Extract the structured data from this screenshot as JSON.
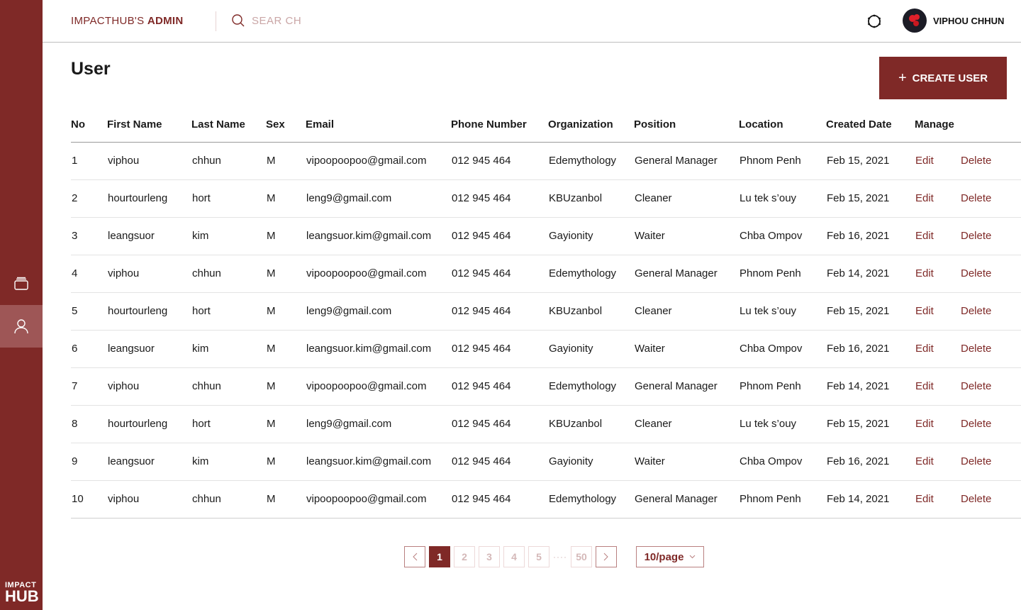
{
  "sidebar": {
    "items": [
      {
        "icon": "cards-icon",
        "label": ""
      },
      {
        "icon": "user-icon",
        "active": true
      }
    ],
    "logo_top": "IMPACT",
    "logo_bottom": "HUB"
  },
  "header": {
    "brand_light": "IMPACTHUB'S",
    "brand_bold": "ADMIN",
    "search_placeholder": "SEAR CH",
    "user_name": "VIPHOU CHHUN"
  },
  "page": {
    "title": "User",
    "create_label": "CREATE USER"
  },
  "colors": {
    "brand": "#7f2927",
    "sidebar_active": "#9e5656"
  },
  "table": {
    "columns": [
      "No",
      "First Name",
      "Last Name",
      "Sex",
      "Email",
      "Phone Number",
      "Organization",
      "Position",
      "Location",
      "Created Date",
      "Manage"
    ],
    "edit_label": "Edit",
    "delete_label": "Delete",
    "rows": [
      [
        "1",
        "viphou",
        "chhun",
        "M",
        "vipoopoopoo@gmail.com",
        "012 945 464",
        "Edemythology",
        "General Manager",
        "Phnom Penh",
        "Feb 15, 2021"
      ],
      [
        "2",
        "hourtourleng",
        "hort",
        "M",
        "leng9@gmail.com",
        "012 945 464",
        "KBUzanbol",
        "Cleaner",
        "Lu tek s’ouy",
        "Feb 15, 2021"
      ],
      [
        "3",
        "leangsuor",
        "kim",
        "M",
        "leangsuor.kim@gmail.com",
        "012 945 464",
        "Gayionity",
        "Waiter",
        "Chba Ompov",
        "Feb 16, 2021"
      ],
      [
        "4",
        "viphou",
        "chhun",
        "M",
        "vipoopoopoo@gmail.com",
        "012 945 464",
        "Edemythology",
        "General Manager",
        "Phnom Penh",
        "Feb 14, 2021"
      ],
      [
        "5",
        "hourtourleng",
        "hort",
        "M",
        "leng9@gmail.com",
        "012 945 464",
        "KBUzanbol",
        "Cleaner",
        "Lu tek s’ouy",
        "Feb 15, 2021"
      ],
      [
        "6",
        "leangsuor",
        "kim",
        "M",
        "leangsuor.kim@gmail.com",
        "012 945 464",
        "Gayionity",
        "Waiter",
        "Chba Ompov",
        "Feb 16, 2021"
      ],
      [
        "7",
        "viphou",
        "chhun",
        "M",
        "vipoopoopoo@gmail.com",
        "012 945 464",
        "Edemythology",
        "General Manager",
        "Phnom Penh",
        "Feb 14, 2021"
      ],
      [
        "8",
        "hourtourleng",
        "hort",
        "M",
        "leng9@gmail.com",
        "012 945 464",
        "KBUzanbol",
        "Cleaner",
        "Lu tek s’ouy",
        "Feb 15, 2021"
      ],
      [
        "9",
        "leangsuor",
        "kim",
        "M",
        "leangsuor.kim@gmail.com",
        "012 945 464",
        "Gayionity",
        "Waiter",
        "Chba Ompov",
        "Feb 16, 2021"
      ],
      [
        "10",
        "viphou",
        "chhun",
        "M",
        "vipoopoopoo@gmail.com",
        "012 945 464",
        "Edemythology",
        "General Manager",
        "Phnom Penh",
        "Feb 14, 2021"
      ]
    ]
  },
  "pagination": {
    "pages": [
      "1",
      "2",
      "3",
      "4",
      "5"
    ],
    "ellipsis": "····",
    "last": "50",
    "current": "1",
    "per_page": "10/page"
  }
}
